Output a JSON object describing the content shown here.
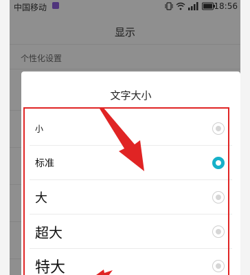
{
  "statusbar": {
    "carrier": "中国移动",
    "time": "18:56",
    "accent_color": "#8a5cd6"
  },
  "appbar": {
    "title": "显示"
  },
  "settings": {
    "section_header": "个性化设置"
  },
  "dialog": {
    "title": "文字大小",
    "options": [
      {
        "label": "小",
        "selected": false
      },
      {
        "label": "标准",
        "selected": true
      },
      {
        "label": "大",
        "selected": false
      },
      {
        "label": "超大",
        "selected": false
      },
      {
        "label": "特大",
        "selected": false
      }
    ],
    "selected_color": "#17b1c9"
  },
  "annotation": {
    "color": "#e02424"
  }
}
